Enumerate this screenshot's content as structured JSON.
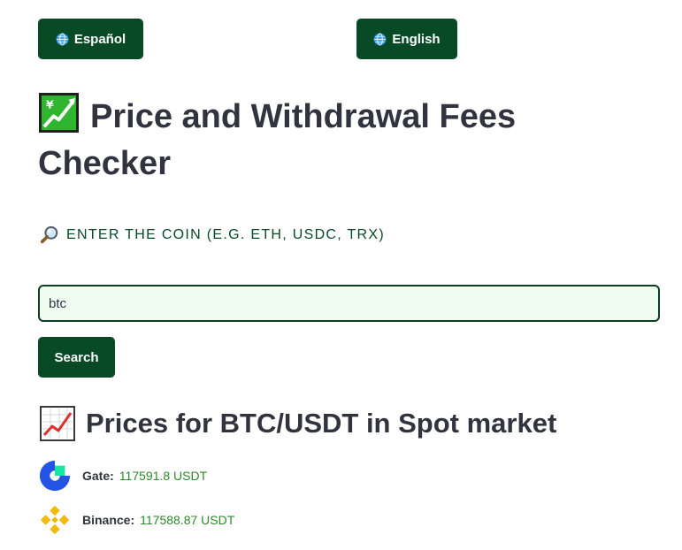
{
  "language_buttons": {
    "spanish_label": "Español",
    "english_label": "English"
  },
  "title": "Price and Withdrawal Fees Checker",
  "coin_prompt": "ENTER THE COIN (E.G. ETH, USDC, TRX)",
  "coin_input": {
    "value": "btc",
    "placeholder": ""
  },
  "search_button_label": "Search",
  "prices_heading": "Prices for BTC/USDT in Spot market",
  "prices": [
    {
      "exchange": "Gate:",
      "price": "117591.8 USDT",
      "logo": "gate-logo"
    },
    {
      "exchange": "Binance:",
      "price": "117588.87 USDT",
      "logo": "binance-logo"
    }
  ],
  "colors": {
    "button_bg": "#074a25",
    "button_text": "#ffffff",
    "prompt_text": "#074a25",
    "input_bg": "#eefdef",
    "input_border": "#0b3f22",
    "price_text": "#2c8a2c",
    "heading_text": "#31333f",
    "gate_blue": "#2354e6",
    "gate_green": "#17e6a1",
    "binance_yellow": "#f0b90b"
  },
  "icons": {
    "language": "globe-icon",
    "title": "chart-increasing-yen-icon",
    "prompt": "magnifying-glass-icon",
    "prices_heading": "chart-increasing-icon"
  }
}
